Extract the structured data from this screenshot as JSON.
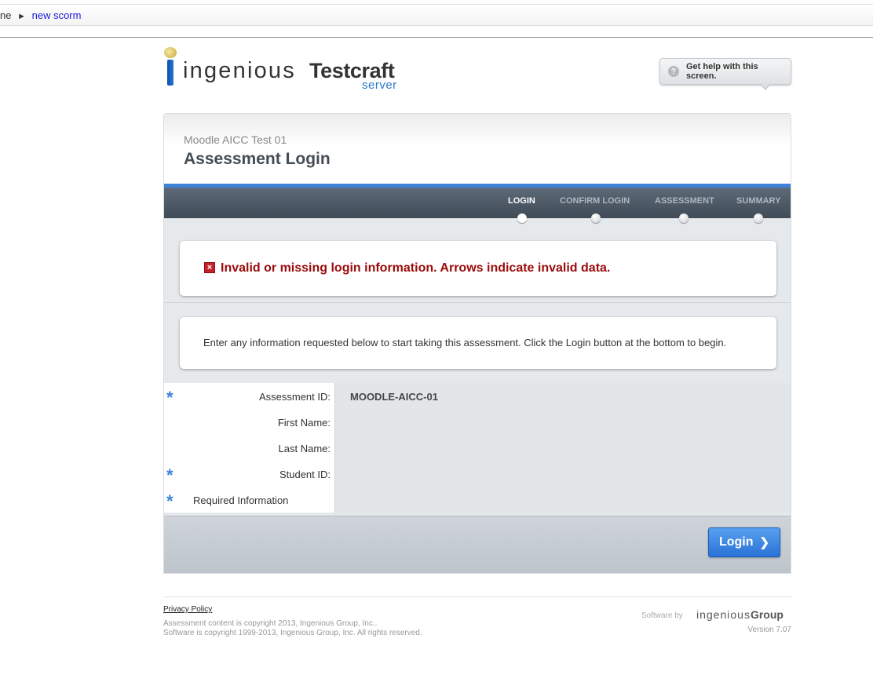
{
  "breadcrumb": {
    "home": "ne",
    "separator": "►",
    "current": "new scorm"
  },
  "logo": {
    "word1": "ingenious",
    "word2": "Testcraft",
    "word3": "server"
  },
  "help": {
    "icon": "question-icon",
    "label": "Get help with this screen."
  },
  "header": {
    "course": "Moodle AICC Test 01",
    "title": "Assessment Login"
  },
  "steps": [
    {
      "label": "LOGIN",
      "active": true
    },
    {
      "label": "CONFIRM LOGIN",
      "active": false
    },
    {
      "label": "ASSESSMENT",
      "active": false
    },
    {
      "label": "SUMMARY",
      "active": false
    }
  ],
  "error": {
    "icon": "error-x-icon",
    "text": "Invalid or missing login information.  Arrows indicate invalid data."
  },
  "info": {
    "text": "Enter any information requested below to start taking this assessment.  Click the Login button at the bottom to begin."
  },
  "form": {
    "assessment_id": {
      "label": "Assessment ID:",
      "value": "MOODLE-AICC-01",
      "required": true
    },
    "first_name": {
      "label": "First Name:",
      "value": "",
      "required": false
    },
    "last_name": {
      "label": "Last Name:",
      "value": "",
      "required": false
    },
    "student_id": {
      "label": "Student ID:",
      "value": "",
      "required": true
    },
    "required_note": "Required Information",
    "required_marker": "*"
  },
  "login_button": {
    "label": "Login",
    "chevron": "❯"
  },
  "footer": {
    "privacy": "Privacy Policy",
    "copyright_content": "Assessment content is copyright 2013, Ingenious Group, Inc..",
    "copyright_software": "Software is copyright 1999-2013, Ingenious Group, Inc.  All rights reserved.",
    "software_by": "Software by",
    "brand_light": "ingenious",
    "brand_bold": "Group",
    "version": "Version 7.07"
  },
  "colors": {
    "accent_blue": "#3d82d8",
    "error_red": "#9a0b0b",
    "step_bar": "#4a5663"
  }
}
